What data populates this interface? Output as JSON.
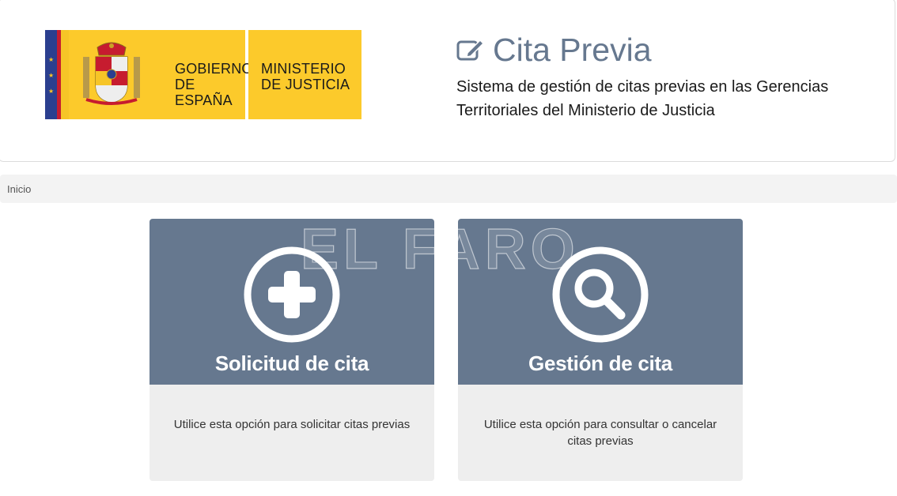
{
  "logo": {
    "government": [
      "GOBIERNO",
      "DE ESPAÑA"
    ],
    "ministry": [
      "MINISTERIO",
      "DE JUSTICIA"
    ]
  },
  "header": {
    "title": "Cita Previa",
    "subtitle_line1": "Sistema de gestión de citas previas en las Gerencias",
    "subtitle_line2": "Territoriales del Ministerio de Justicia",
    "title_icon": "edit-icon"
  },
  "breadcrumb": {
    "current": "Inicio"
  },
  "cards": [
    {
      "title": "Solicitud de cita",
      "description": "Utilice esta opción para solicitar citas previas",
      "icon": "plus-circle-icon"
    },
    {
      "title": "Gestión de cita",
      "description": "Utilice esta opción para consultar o cancelar citas previas",
      "icon": "search-circle-icon"
    }
  ],
  "watermark": "EL FARO",
  "colors": {
    "accent": "#66788f",
    "logo_yellow": "#fcca2b",
    "card_bottom": "#eeeeee",
    "breadcrumb_bg": "#f3f3f3"
  }
}
